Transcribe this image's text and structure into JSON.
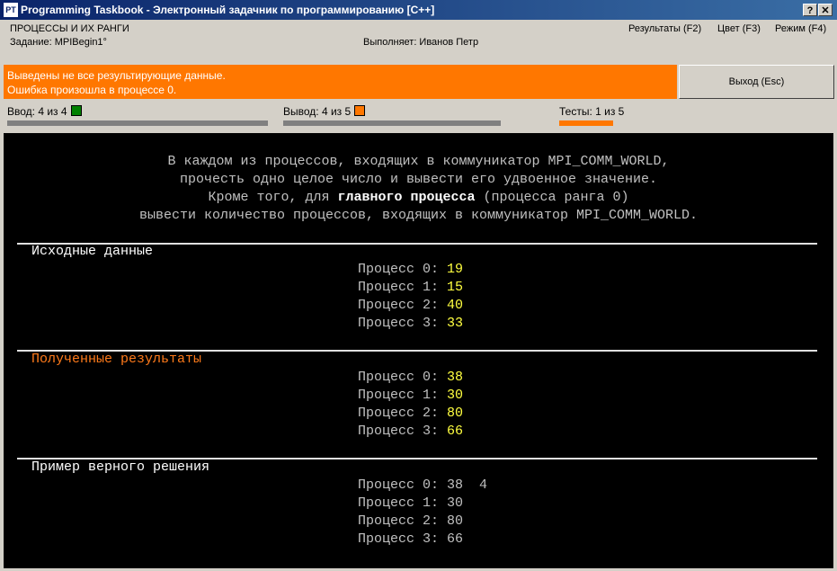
{
  "window": {
    "title": "Programming Taskbook - Электронный задачник по программированию [C++]",
    "icon_text": "PT",
    "help_label": "?",
    "close_label": "✕"
  },
  "header": {
    "group": "ПРОЦЕССЫ И ИХ РАНГИ",
    "task": "Задание: MPIBegin1°",
    "performer": "Выполняет: Иванов Петр",
    "menu": {
      "results": "Результаты (F2)",
      "color": "Цвет (F3)",
      "mode": "Режим (F4)"
    }
  },
  "error": {
    "line1": "Выведены не все результирующие данные.",
    "line2": "Ошибка произошла в процессе 0.",
    "color": "#ff7700"
  },
  "exit_button": "Выход (Esc)",
  "status": {
    "input": {
      "label": "Ввод: 4 из 4",
      "color": "#008000"
    },
    "output": {
      "label": "Вывод: 4 из 5",
      "color": "#ff7700"
    },
    "tests": {
      "label": "Тесты: 1 из 5",
      "color": "#ff7700"
    }
  },
  "task_text": {
    "line1": "В каждом из процессов, входящих в коммуникатор MPI_COMM_WORLD,",
    "line2": "прочесть одно целое число и вывести его удвоенное значение.",
    "line3_pre": "Кроме того, для ",
    "line3_bold": "главного процесса",
    "line3_post": " (процесса ранга 0)",
    "line4": "вывести количество процессов, входящих в коммуникатор MPI_COMM_WORLD."
  },
  "sections": {
    "input": {
      "title": "Исходные данные",
      "rows": [
        {
          "label": "Процесс 0:",
          "value": "19"
        },
        {
          "label": "Процесс 1:",
          "value": "15"
        },
        {
          "label": "Процесс 2:",
          "value": "40"
        },
        {
          "label": "Процесс 3:",
          "value": "33"
        }
      ]
    },
    "results": {
      "title": "Полученные результаты",
      "rows": [
        {
          "label": "Процесс 0:",
          "value": "38"
        },
        {
          "label": "Процесс 1:",
          "value": "30"
        },
        {
          "label": "Процесс 2:",
          "value": "80"
        },
        {
          "label": "Процесс 3:",
          "value": "66"
        }
      ]
    },
    "example": {
      "title": "Пример верного решения",
      "rows": [
        {
          "label": "Процесс 0:",
          "value": "38  4"
        },
        {
          "label": "Процесс 1:",
          "value": "30"
        },
        {
          "label": "Процесс 2:",
          "value": "80"
        },
        {
          "label": "Процесс 3:",
          "value": "66"
        }
      ]
    }
  }
}
